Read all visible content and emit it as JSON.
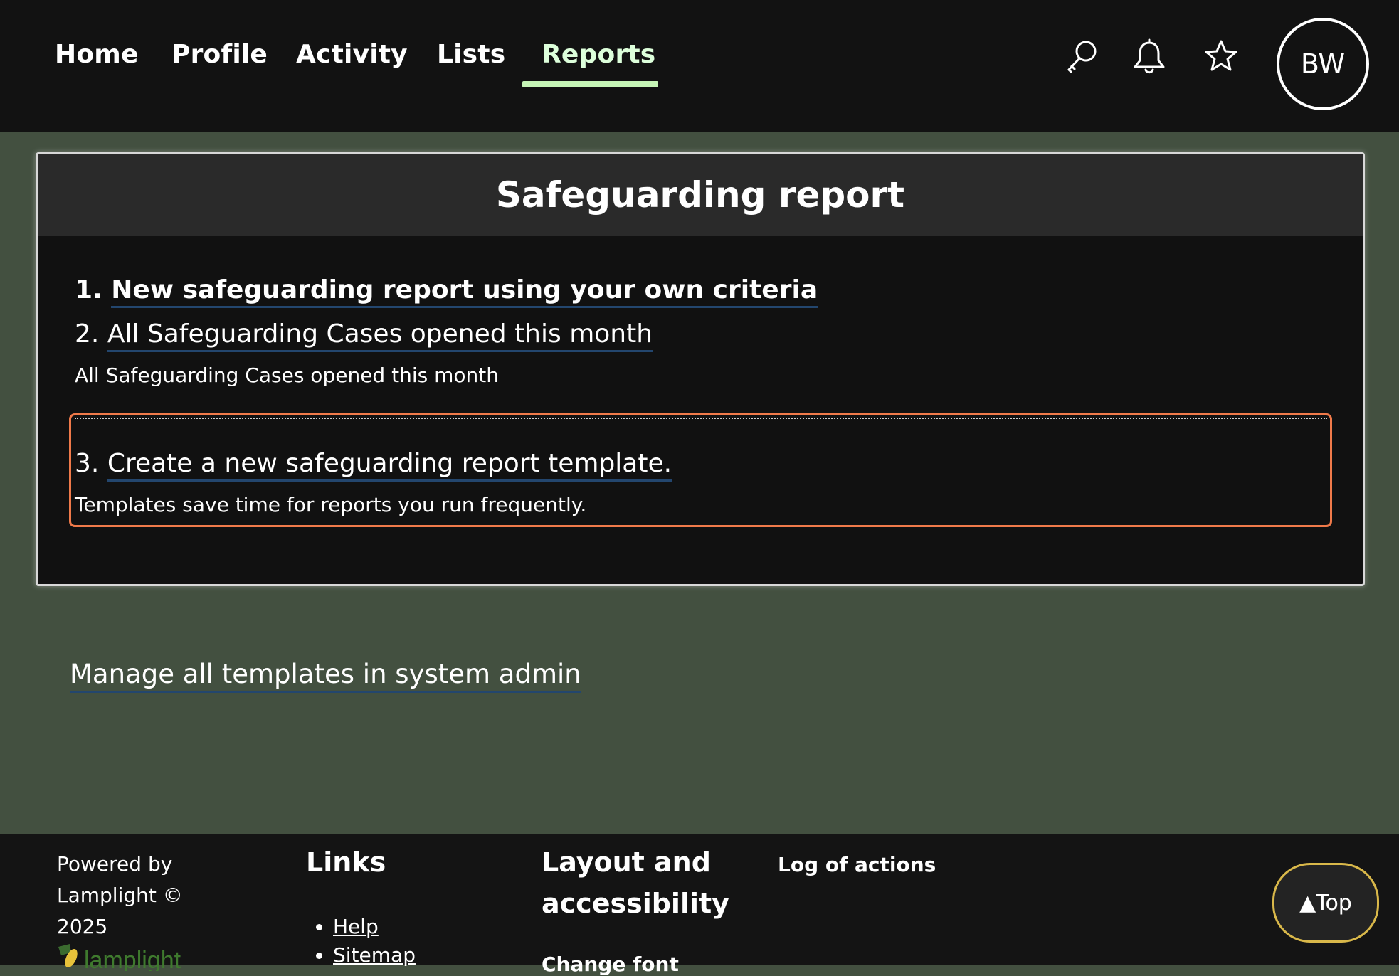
{
  "nav": {
    "items": [
      {
        "label": "Home"
      },
      {
        "label": "Profile"
      },
      {
        "label": "Activity"
      },
      {
        "label": "Lists"
      },
      {
        "label": "Reports",
        "active": true
      }
    ],
    "icons": [
      "search-icon",
      "bell-icon",
      "star-icon"
    ],
    "avatar_initials": "BW"
  },
  "card": {
    "title": "Safeguarding report",
    "reports": [
      {
        "number": "1.",
        "label": "New safeguarding report using your own criteria"
      },
      {
        "number": "2.",
        "label": "All Safeguarding Cases opened this month",
        "description": "All Safeguarding Cases opened this month"
      },
      {
        "number": "3.",
        "label": "Create a new safeguarding report template.",
        "description": "Templates save time for reports you run frequently."
      }
    ]
  },
  "manage_link": "Manage all templates in system admin",
  "footer": {
    "powered_by": "Powered by Lamplight © 2025",
    "links_heading": "Links",
    "links": [
      "Help",
      "Sitemap"
    ],
    "layout_heading": "Layout and accessibility",
    "layout_item": "Change font",
    "log_heading": "Log of actions",
    "top_button": "▲Top"
  },
  "colors": {
    "page_bg": "#435040",
    "bar_bg": "#121212",
    "active_tab_underline": "#c6f5b6",
    "highlight_border": "#f07a4a",
    "link_underline": "#23466e",
    "top_button_border": "#d9b84a"
  }
}
